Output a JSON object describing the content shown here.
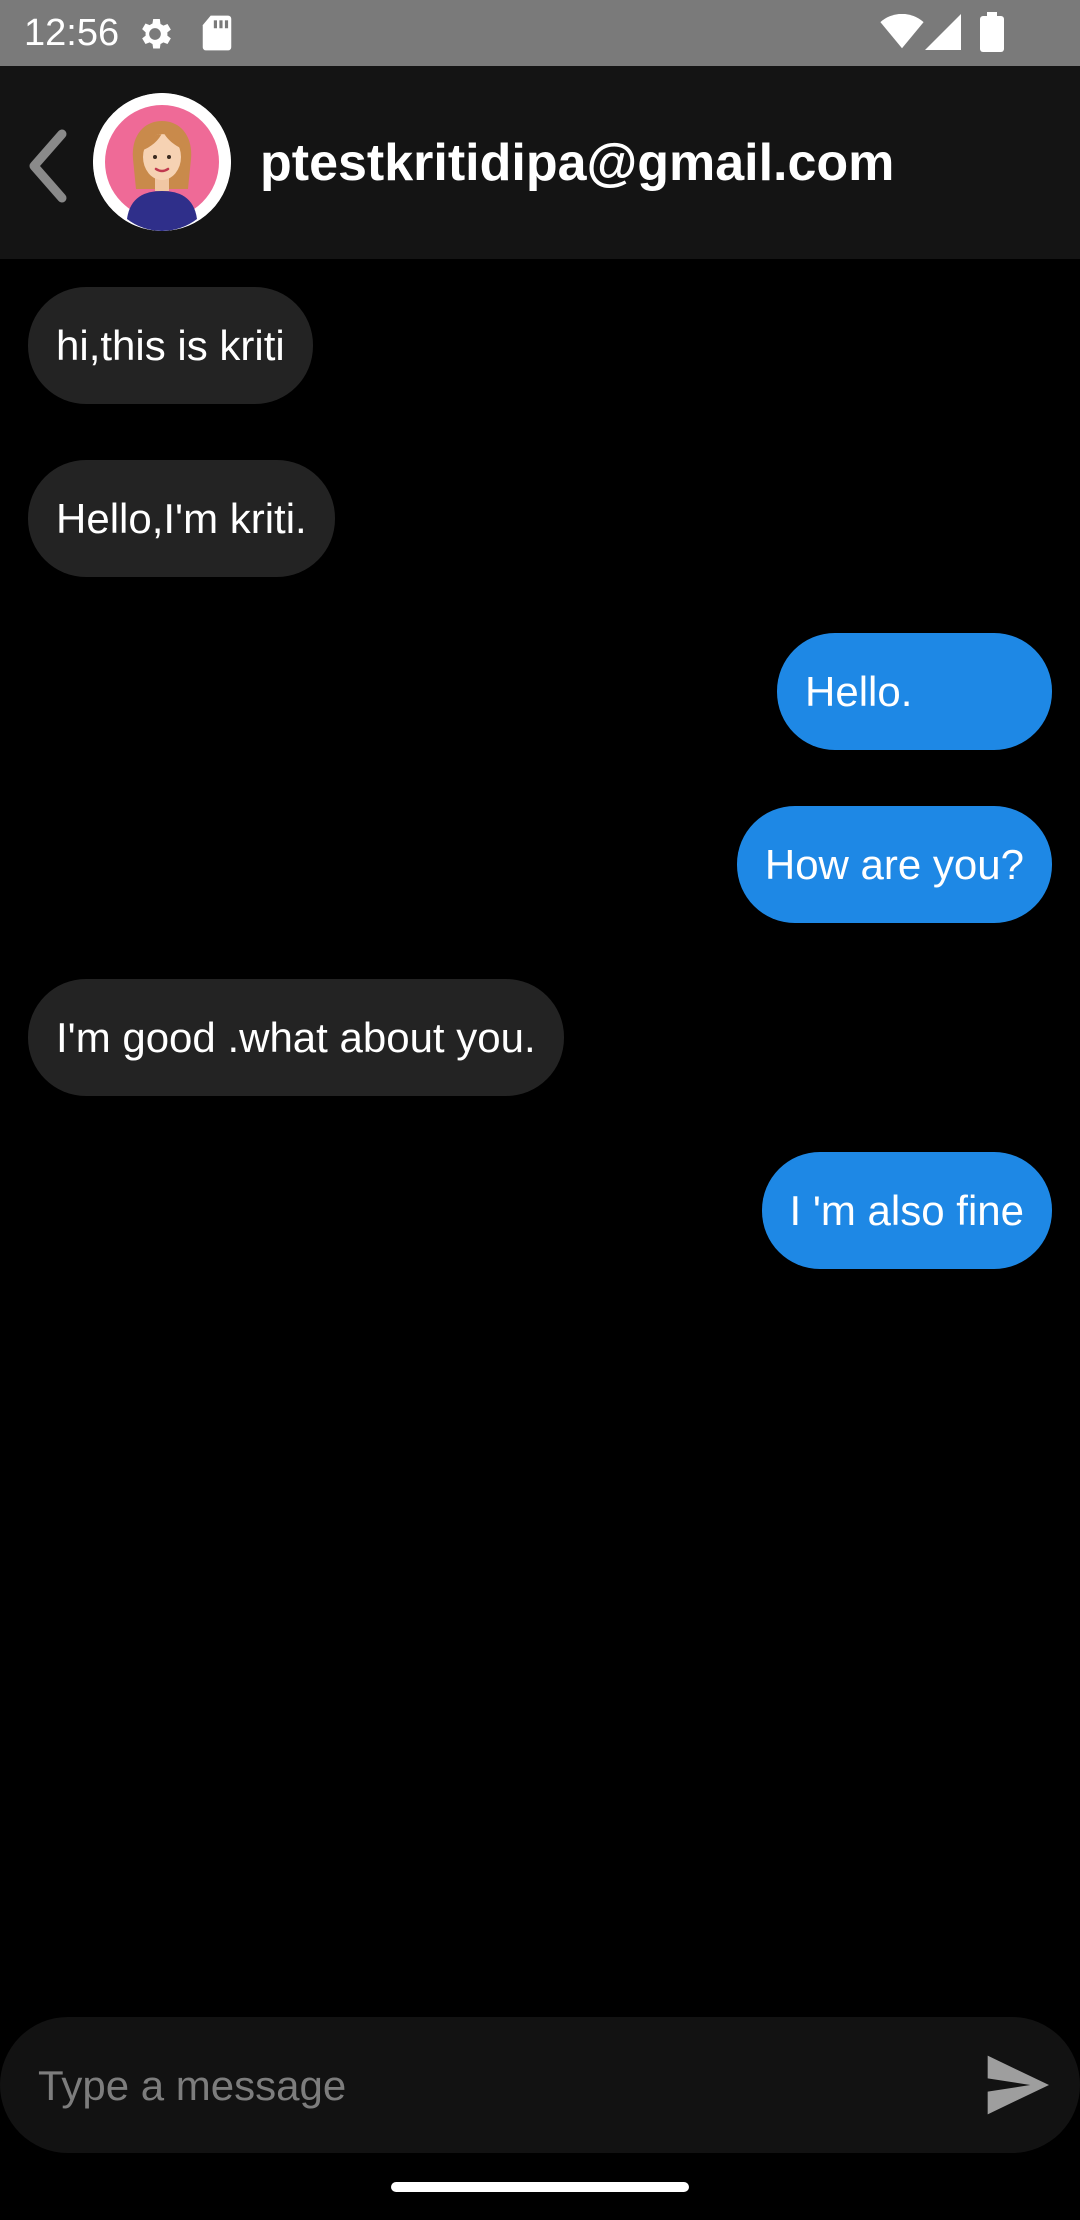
{
  "status_bar": {
    "time": "12:56",
    "icons": [
      "settings-icon",
      "sd-card-icon",
      "wifi-icon",
      "signal-icon",
      "battery-icon"
    ]
  },
  "header": {
    "back_icon": "chevron-left-icon",
    "avatar": "avatar",
    "contact_name": "ptestkritidipa@gmail.com"
  },
  "messages": [
    {
      "direction": "incoming",
      "text": "hi,this is kriti"
    },
    {
      "direction": "incoming",
      "text": "Hello,I'm kriti."
    },
    {
      "direction": "outgoing",
      "text": "Hello."
    },
    {
      "direction": "outgoing",
      "text": "How are you?"
    },
    {
      "direction": "incoming",
      "text": "I'm good .what about you."
    },
    {
      "direction": "outgoing",
      "text": "I 'm also fine"
    }
  ],
  "composer": {
    "placeholder": "Type a message",
    "value": "",
    "send_icon": "send-icon"
  },
  "colors": {
    "background": "#000000",
    "status_bar": "#7a7a7a",
    "app_bar": "#141414",
    "incoming_bubble": "#232323",
    "outgoing_bubble": "#1e88e5",
    "composer": "#121212",
    "placeholder_text": "#7d7d7d"
  }
}
